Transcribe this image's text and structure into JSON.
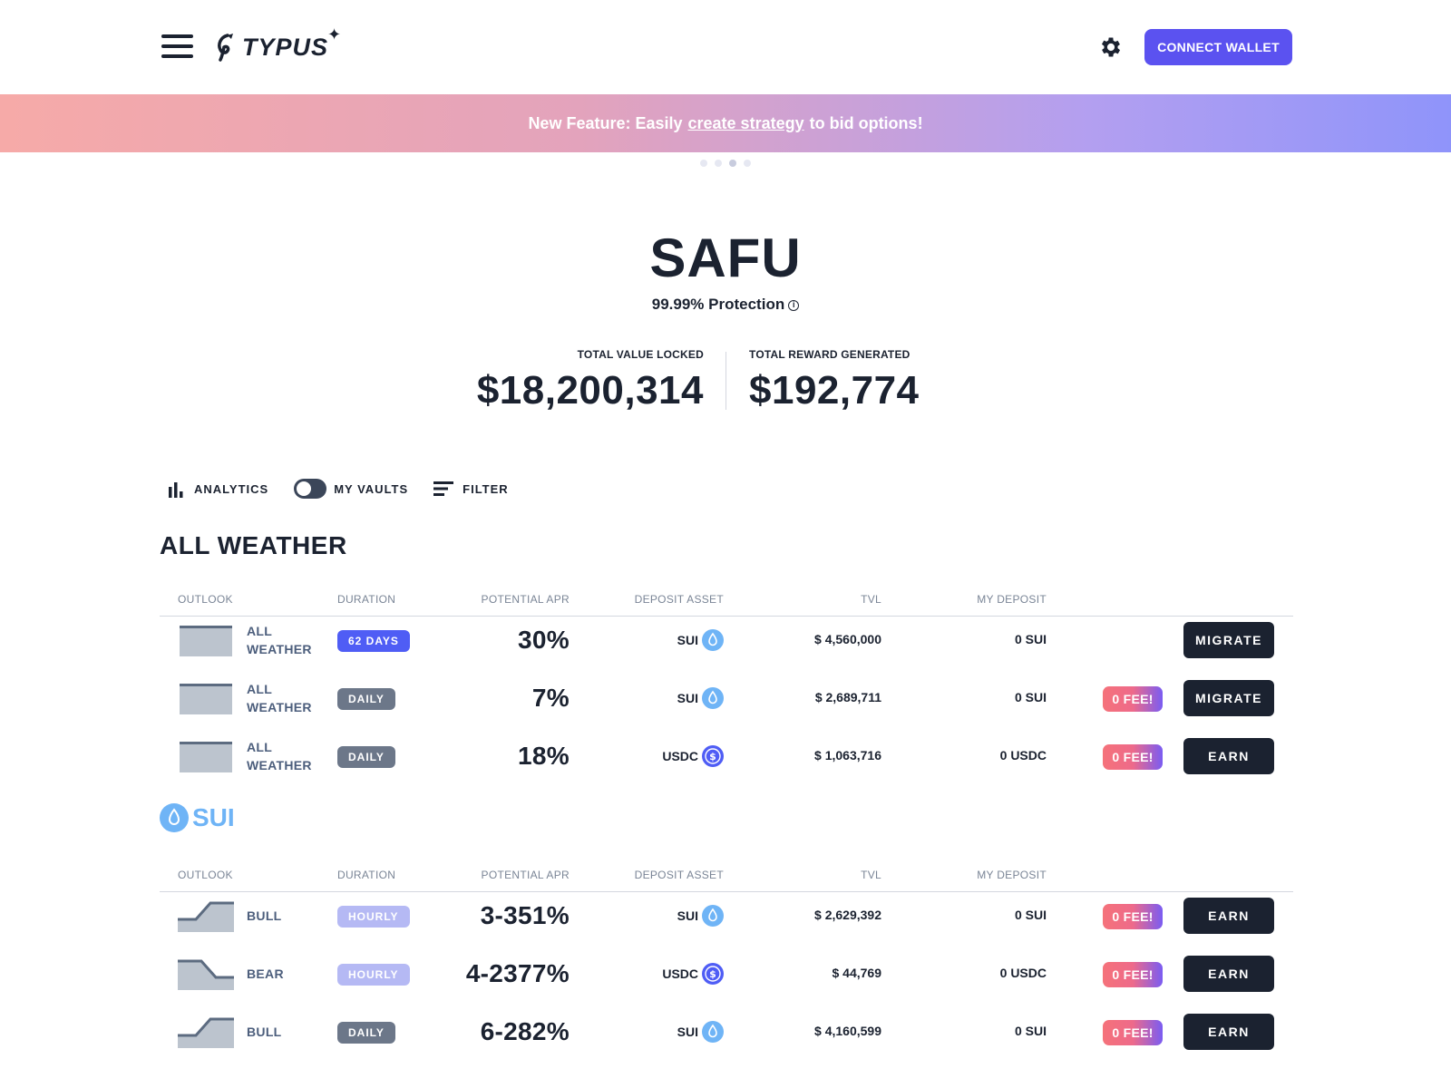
{
  "header": {
    "logo_text": "TYPUS",
    "connect_label": "CONNECT WALLET"
  },
  "banner": {
    "prefix": "New Feature: Easily",
    "link": "create strategy",
    "suffix": "to bid options!",
    "slide_count": 4,
    "active_slide": 3
  },
  "hero": {
    "title": "SAFU",
    "subtitle": "99.99% Protection",
    "tvl_label": "TOTAL VALUE LOCKED",
    "tvl_value": "$18,200,314",
    "reward_label": "TOTAL REWARD GENERATED",
    "reward_value": "$192,774"
  },
  "toolbar": {
    "analytics": "ANALYTICS",
    "my_vaults": "MY VAULTS",
    "filter": "FILTER"
  },
  "columns": {
    "outlook": "OUTLOOK",
    "duration": "DURATION",
    "apr": "POTENTIAL APR",
    "asset": "DEPOSIT ASSET",
    "tvl": "TVL",
    "my_deposit": "MY DEPOSIT"
  },
  "all_weather": {
    "title": "ALL WEATHER",
    "rows": [
      {
        "outlook": "ALL WEATHER",
        "duration": "62 DAYS",
        "apr": "30%",
        "asset": "SUI",
        "tvl": "$ 4,560,000",
        "my_deposit": "0 SUI",
        "fee": "",
        "action": "MIGRATE"
      },
      {
        "outlook": "ALL WEATHER",
        "duration": "DAILY",
        "apr": "7%",
        "asset": "SUI",
        "tvl": "$ 2,689,711",
        "my_deposit": "0 SUI",
        "fee": "0 FEE!",
        "action": "MIGRATE"
      },
      {
        "outlook": "ALL WEATHER",
        "duration": "DAILY",
        "apr": "18%",
        "asset": "USDC",
        "tvl": "$ 1,063,716",
        "my_deposit": "0 USDC",
        "fee": "0 FEE!",
        "action": "EARN"
      }
    ]
  },
  "sui": {
    "title": "SUI",
    "rows": [
      {
        "outlook": "BULL",
        "duration": "HOURLY",
        "apr": "3-351%",
        "asset": "SUI",
        "tvl": "$ 2,629,392",
        "my_deposit": "0 SUI",
        "fee": "0 FEE!",
        "action": "EARN"
      },
      {
        "outlook": "BEAR",
        "duration": "HOURLY",
        "apr": "4-2377%",
        "asset": "USDC",
        "tvl": "$ 44,769",
        "my_deposit": "0 USDC",
        "fee": "0 FEE!",
        "action": "EARN"
      },
      {
        "outlook": "BULL",
        "duration": "DAILY",
        "apr": "6-282%",
        "asset": "SUI",
        "tvl": "$ 4,160,599",
        "my_deposit": "0 SUI",
        "fee": "0 FEE!",
        "action": "EARN"
      }
    ]
  },
  "colors": {
    "primary": "#5b52f0",
    "dark": "#1b2230",
    "sui_blue": "#6fb4f6",
    "usdc_blue": "#4f5df5"
  }
}
